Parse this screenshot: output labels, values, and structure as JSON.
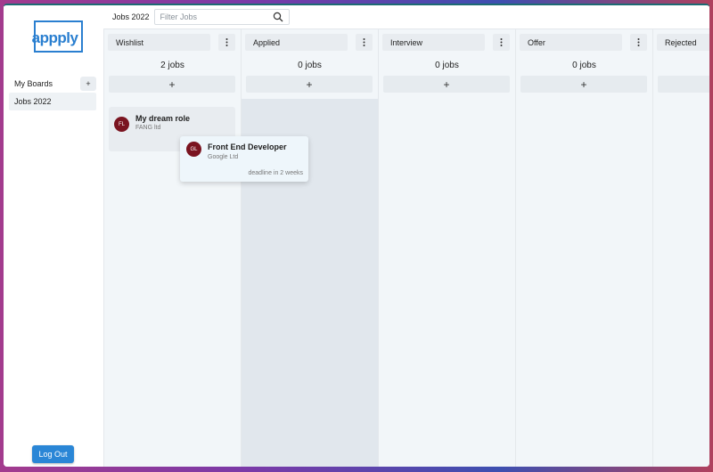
{
  "sidebar": {
    "logo_text": "appply",
    "boards_label": "My Boards",
    "add_board_label": "+",
    "boards": [
      {
        "label": "Jobs 2022"
      }
    ],
    "logout_label": "Log Out"
  },
  "topbar": {
    "board_title": "Jobs 2022",
    "search_placeholder": "Filter Jobs"
  },
  "columns": [
    {
      "name": "Wishlist",
      "count": "2 jobs",
      "add_label": "+"
    },
    {
      "name": "Applied",
      "count": "0 jobs",
      "add_label": "+"
    },
    {
      "name": "Interview",
      "count": "0 jobs",
      "add_label": "+"
    },
    {
      "name": "Offer",
      "count": "0 jobs",
      "add_label": "+"
    },
    {
      "name": "Rejected",
      "count": "",
      "add_label": ""
    }
  ],
  "cards": [
    {
      "initials": "FL",
      "title": "My dream role",
      "company": "FANG ltd"
    }
  ],
  "dragging_card": {
    "initials": "GL",
    "title": "Front End Developer",
    "company": "Google Ltd",
    "deadline": "deadline in 2 weeks"
  },
  "colors": {
    "accent": "#2a86d6",
    "avatar": "#7a1420",
    "column_bg": "#f2f6f9",
    "drop_highlight": "#e1e7ed"
  },
  "icons": {
    "search": "search-icon",
    "menu": "kebab-menu-icon"
  }
}
